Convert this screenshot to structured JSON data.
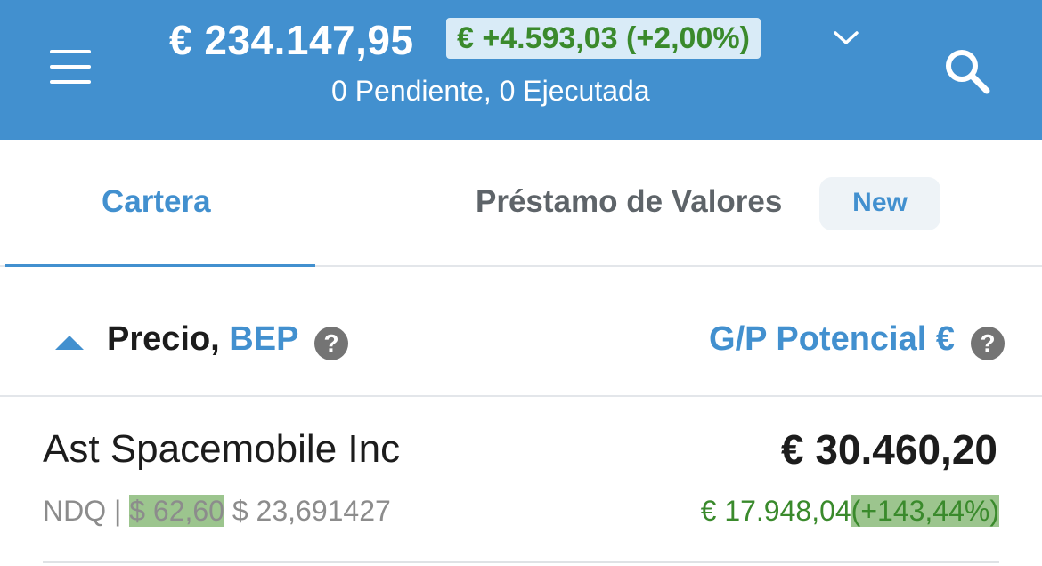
{
  "header": {
    "balance": "€ 234.147,95",
    "change": "€ +4.593,03 (+2,00%)",
    "subtitle": "0 Pendiente, 0 Ejecutada",
    "background_color": "#4290cf",
    "change_color": "#3a8a2c"
  },
  "icons": {
    "menu": "menu-icon",
    "dropdown": "chevron-down-icon",
    "search": "search-icon",
    "sort": "sort-up-icon",
    "help": "help-icon"
  },
  "tabs": [
    {
      "label": "Cartera",
      "active": true
    },
    {
      "label": "Préstamo de Valores",
      "badge": "New",
      "active": false
    }
  ],
  "list_header": {
    "left_label": "Precio,",
    "left_label_accent": "BEP",
    "help_glyph": "?",
    "right_label": "G/P Potencial €"
  },
  "holdings": [
    {
      "name": "Ast Spacemobile Inc",
      "exchange": "NDQ",
      "separator": "|",
      "price": "$ 62,60",
      "bep": "$ 23,691427",
      "value": "€ 30.460,20",
      "pl_amount": "€ 17.948,04",
      "pl_percent": "(+143,44%)"
    }
  ]
}
